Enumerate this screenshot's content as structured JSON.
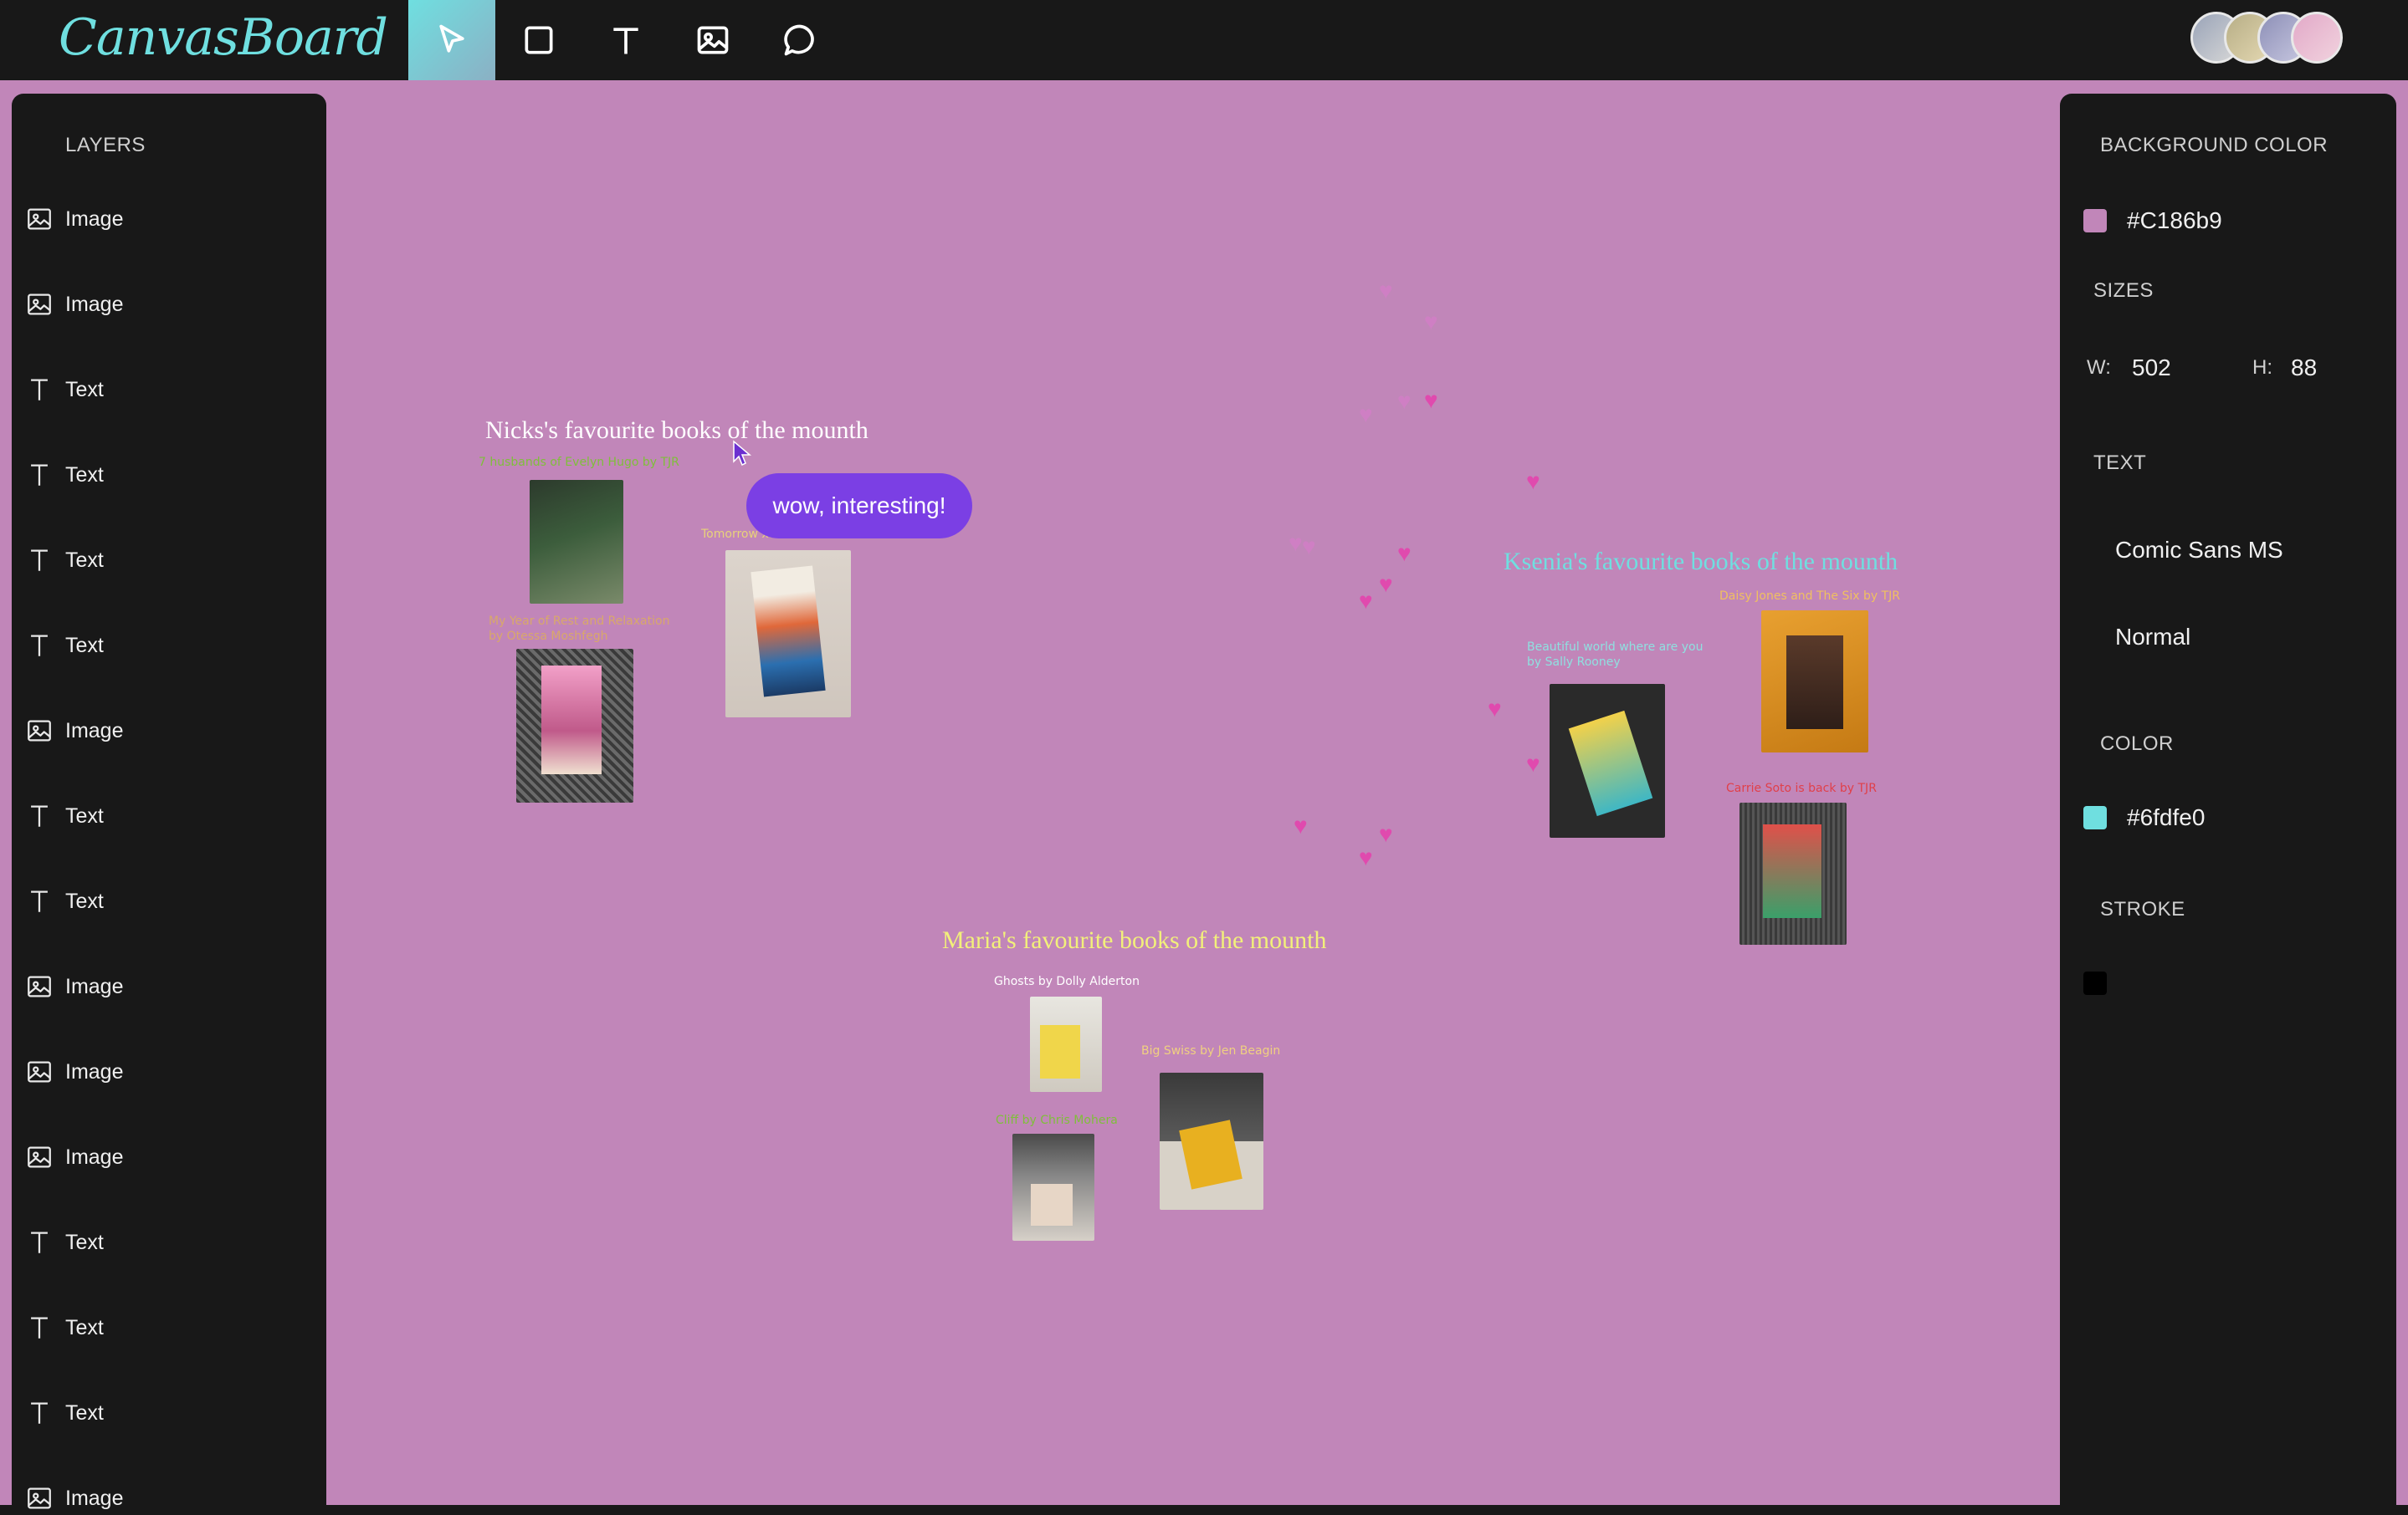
{
  "app": {
    "logo": "CanvasBoard"
  },
  "toolbar": {
    "tools": [
      {
        "name": "select",
        "icon": "cursor-icon",
        "active": true
      },
      {
        "name": "rectangle",
        "icon": "square-icon"
      },
      {
        "name": "text",
        "icon": "text-icon"
      },
      {
        "name": "image",
        "icon": "image-icon"
      },
      {
        "name": "comment",
        "icon": "speech-bubble-icon"
      }
    ],
    "accent": "#6fdfe0"
  },
  "layers": {
    "title": "LAYERS",
    "items": [
      {
        "type": "image",
        "label": "Image"
      },
      {
        "type": "image",
        "label": "Image"
      },
      {
        "type": "text",
        "label": "Text"
      },
      {
        "type": "text",
        "label": "Text"
      },
      {
        "type": "text",
        "label": "Text"
      },
      {
        "type": "text",
        "label": "Text"
      },
      {
        "type": "image",
        "label": "Image"
      },
      {
        "type": "text",
        "label": "Text"
      },
      {
        "type": "text",
        "label": "Text"
      },
      {
        "type": "image",
        "label": "Image"
      },
      {
        "type": "image",
        "label": "Image"
      },
      {
        "type": "image",
        "label": "Image"
      },
      {
        "type": "text",
        "label": "Text"
      },
      {
        "type": "text",
        "label": "Text"
      },
      {
        "type": "text",
        "label": "Text"
      },
      {
        "type": "image",
        "label": "Image"
      }
    ]
  },
  "properties": {
    "background": {
      "title": "BACKGROUND COLOR",
      "value": "#C186b9",
      "color": "#c186b9"
    },
    "sizes": {
      "title": "SIZES",
      "w_label": "W:",
      "w_value": "502",
      "h_label": "H:",
      "h_value": "88"
    },
    "text": {
      "title": "TEXT",
      "font": "Comic Sans MS",
      "weight": "Normal"
    },
    "color": {
      "title": "COLOR",
      "value": "#6fdfe0",
      "color": "#6fdfe0"
    },
    "stroke": {
      "title": "STROKE",
      "color": "#000000"
    }
  },
  "canvas": {
    "background": "#c186b9",
    "comment": "wow, interesting!",
    "nick": {
      "title": "Nicks's favourite books of the mounth",
      "cap1": "7 husbands of Evelyn Hugo by TJR",
      "cap2_l1": "My Year of Rest and Relaxation",
      "cap2_l2": "by Otessa Moshfegh",
      "cap3": "Tomorrow x3"
    },
    "ksenia": {
      "title": "Ksenia's favourite books of the mounth",
      "cap1": "Daisy Jones and The Six by TJR",
      "cap2_l1": "Beautiful world where are you",
      "cap2_l2": "by Sally Rooney",
      "cap3": "Carrie Soto is back by TJR"
    },
    "maria": {
      "title": "Maria's favourite books of the mounth",
      "cap1": "Ghosts by Dolly Alderton",
      "cap2": "Big Swiss by Jen Beagin",
      "cap3": "Cliff by Chris Mohera"
    }
  }
}
